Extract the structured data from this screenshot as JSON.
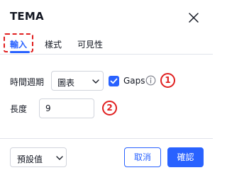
{
  "dialog": {
    "title": "TEMA",
    "close_icon": "close-icon"
  },
  "tabs": [
    {
      "label": "輸入",
      "active": true
    },
    {
      "label": "樣式",
      "active": false
    },
    {
      "label": "可見性",
      "active": false
    }
  ],
  "inputs": {
    "period_label": "時間週期",
    "period_value": "圖表",
    "gaps_checked": true,
    "gaps_label": "Gaps",
    "info_icon": "info-circle-icon",
    "length_label": "長度",
    "length_value": "9"
  },
  "annotations": [
    "1",
    "2"
  ],
  "footer": {
    "preset_label": "預設值",
    "cancel_label": "取消",
    "ok_label": "確認"
  },
  "colors": {
    "accent": "#2962ff",
    "annotation": "#e01f1f",
    "border": "#d1d4dc"
  }
}
